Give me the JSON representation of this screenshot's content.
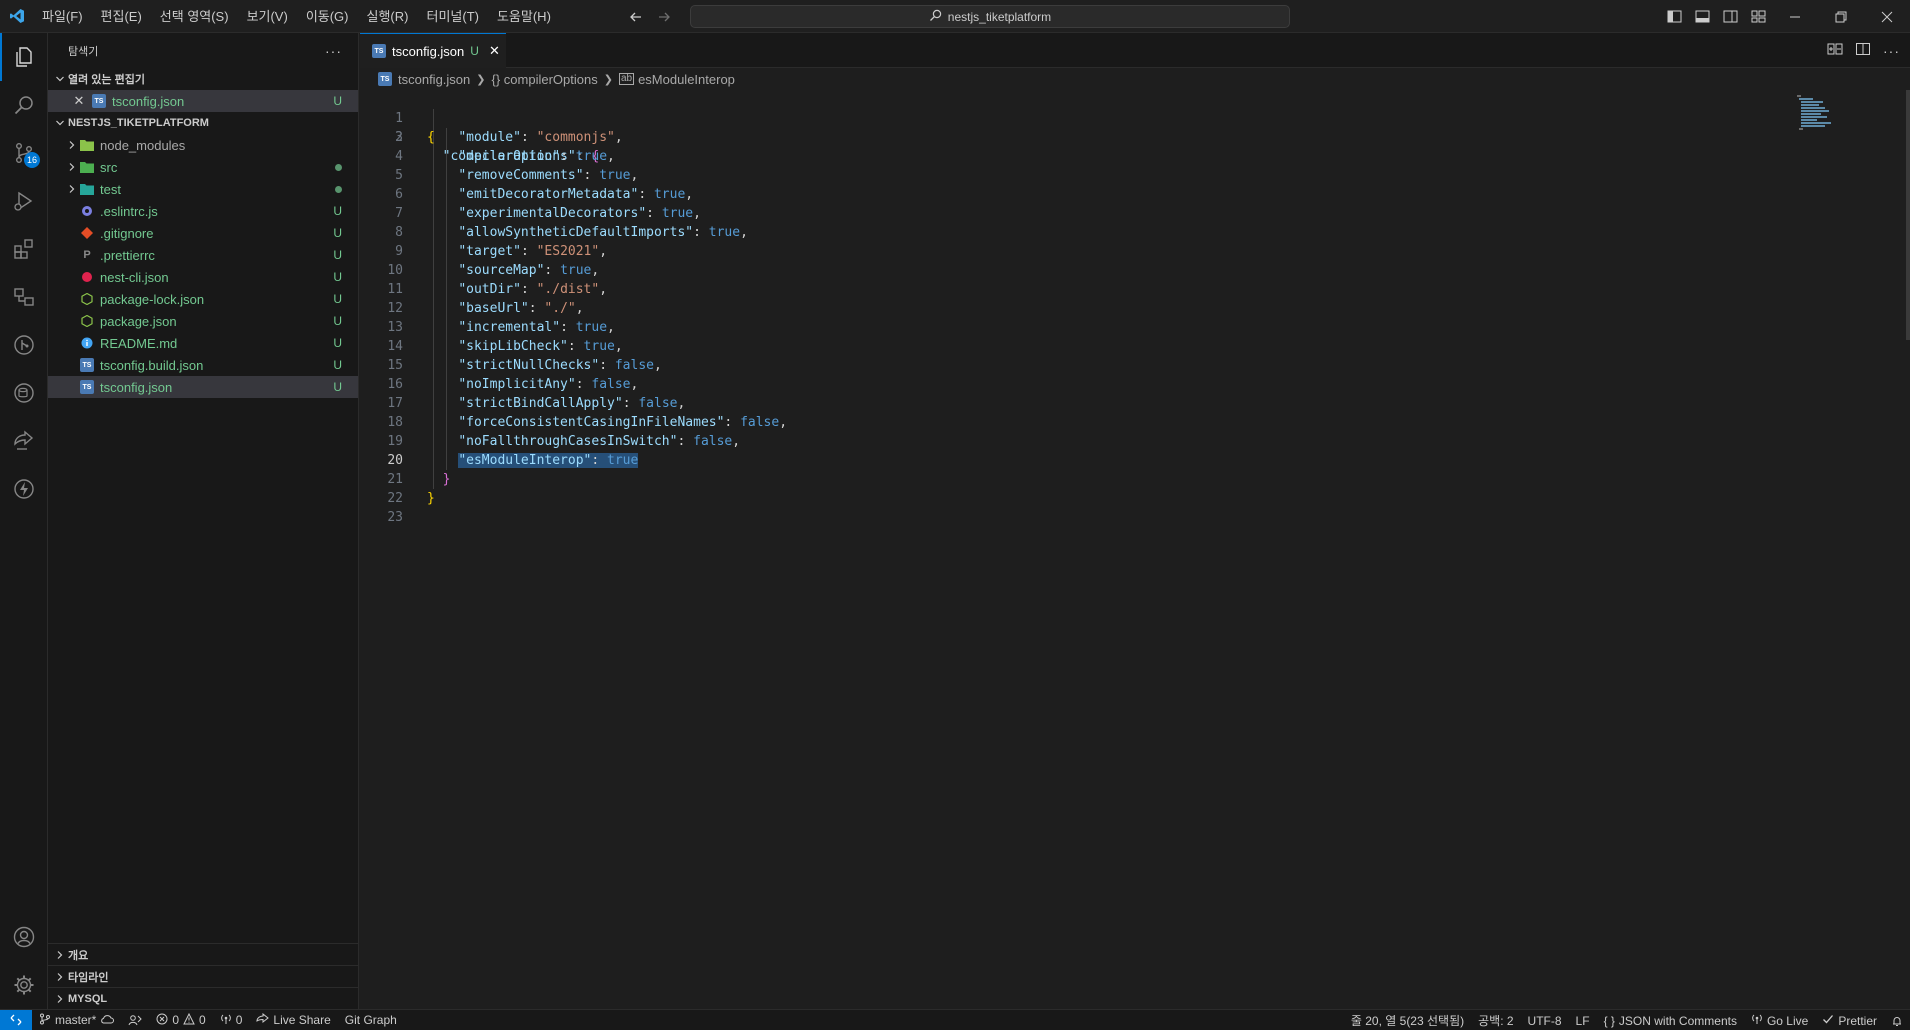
{
  "menu": [
    "파일(F)",
    "편집(E)",
    "선택 영역(S)",
    "보기(V)",
    "이동(G)",
    "실행(R)",
    "터미널(T)",
    "도움말(H)"
  ],
  "search": {
    "text": "nestjs_tiketplatform"
  },
  "activity": {
    "scm_badge": "16"
  },
  "sidebar": {
    "title": "탐색기",
    "open_editors_label": "열려 있는 편집기",
    "open_editor": {
      "name": "tsconfig.json",
      "status": "U"
    },
    "project_label": "NESTJS_TIKETPLATFORM",
    "tree": [
      {
        "name": "node_modules",
        "status": ""
      },
      {
        "name": "src",
        "status": ""
      },
      {
        "name": "test",
        "status": ""
      },
      {
        "name": ".eslintrc.js",
        "status": "U"
      },
      {
        "name": ".gitignore",
        "status": "U"
      },
      {
        "name": ".prettierrc",
        "status": "U"
      },
      {
        "name": "nest-cli.json",
        "status": "U"
      },
      {
        "name": "package-lock.json",
        "status": "U"
      },
      {
        "name": "package.json",
        "status": "U"
      },
      {
        "name": "README.md",
        "status": "U"
      },
      {
        "name": "tsconfig.build.json",
        "status": "U"
      },
      {
        "name": "tsconfig.json",
        "status": "U"
      }
    ],
    "bottom_sections": [
      "개요",
      "타임라인",
      "MYSQL"
    ]
  },
  "tab": {
    "name": "tsconfig.json",
    "status": "U"
  },
  "breadcrumb": [
    "tsconfig.json",
    "{} compilerOptions",
    "esModuleInterop"
  ],
  "editor": {
    "current_line": "20",
    "lines": [
      {
        "n": "1",
        "key": "",
        "val": ""
      },
      {
        "n": "2",
        "key": "\"compilerOptions\"",
        "val": ""
      },
      {
        "n": "3",
        "key": "\"module\"",
        "val": "\"commonjs\""
      },
      {
        "n": "4",
        "key": "\"declaration\"",
        "val": "true"
      },
      {
        "n": "5",
        "key": "\"removeComments\"",
        "val": "true"
      },
      {
        "n": "6",
        "key": "\"emitDecoratorMetadata\"",
        "val": "true"
      },
      {
        "n": "7",
        "key": "\"experimentalDecorators\"",
        "val": "true"
      },
      {
        "n": "8",
        "key": "\"allowSyntheticDefaultImports\"",
        "val": "true"
      },
      {
        "n": "9",
        "key": "\"target\"",
        "val": "\"ES2021\""
      },
      {
        "n": "10",
        "key": "\"sourceMap\"",
        "val": "true"
      },
      {
        "n": "11",
        "key": "\"outDir\"",
        "val": "\"./dist\""
      },
      {
        "n": "12",
        "key": "\"baseUrl\"",
        "val": "\"./\""
      },
      {
        "n": "13",
        "key": "\"incremental\"",
        "val": "true"
      },
      {
        "n": "14",
        "key": "\"skipLibCheck\"",
        "val": "true"
      },
      {
        "n": "15",
        "key": "\"strictNullChecks\"",
        "val": "false"
      },
      {
        "n": "16",
        "key": "\"noImplicitAny\"",
        "val": "false"
      },
      {
        "n": "17",
        "key": "\"strictBindCallApply\"",
        "val": "false"
      },
      {
        "n": "18",
        "key": "\"forceConsistentCasingInFileNames\"",
        "val": "false"
      },
      {
        "n": "19",
        "key": "\"noFallthroughCasesInSwitch\"",
        "val": "false"
      },
      {
        "n": "20",
        "key": "\"esModuleInterop\"",
        "val": "true"
      },
      {
        "n": "21",
        "key": "",
        "val": ""
      },
      {
        "n": "22",
        "key": "",
        "val": ""
      },
      {
        "n": "23",
        "key": "",
        "val": ""
      }
    ]
  },
  "status": {
    "branch": "master*",
    "errors": "0",
    "warnings": "0",
    "ports": "0",
    "live_share": "Live Share",
    "git_graph": "Git Graph",
    "cursor": "줄 20, 열 5(23 선택됨)",
    "spaces": "공백: 2",
    "encoding": "UTF-8",
    "eol": "LF",
    "language": "JSON with Comments",
    "go_live": "Go Live",
    "prettier": "Prettier"
  },
  "colors": {
    "accent": "#0078d4",
    "untracked": "#73c991",
    "selection": "#264f78"
  }
}
